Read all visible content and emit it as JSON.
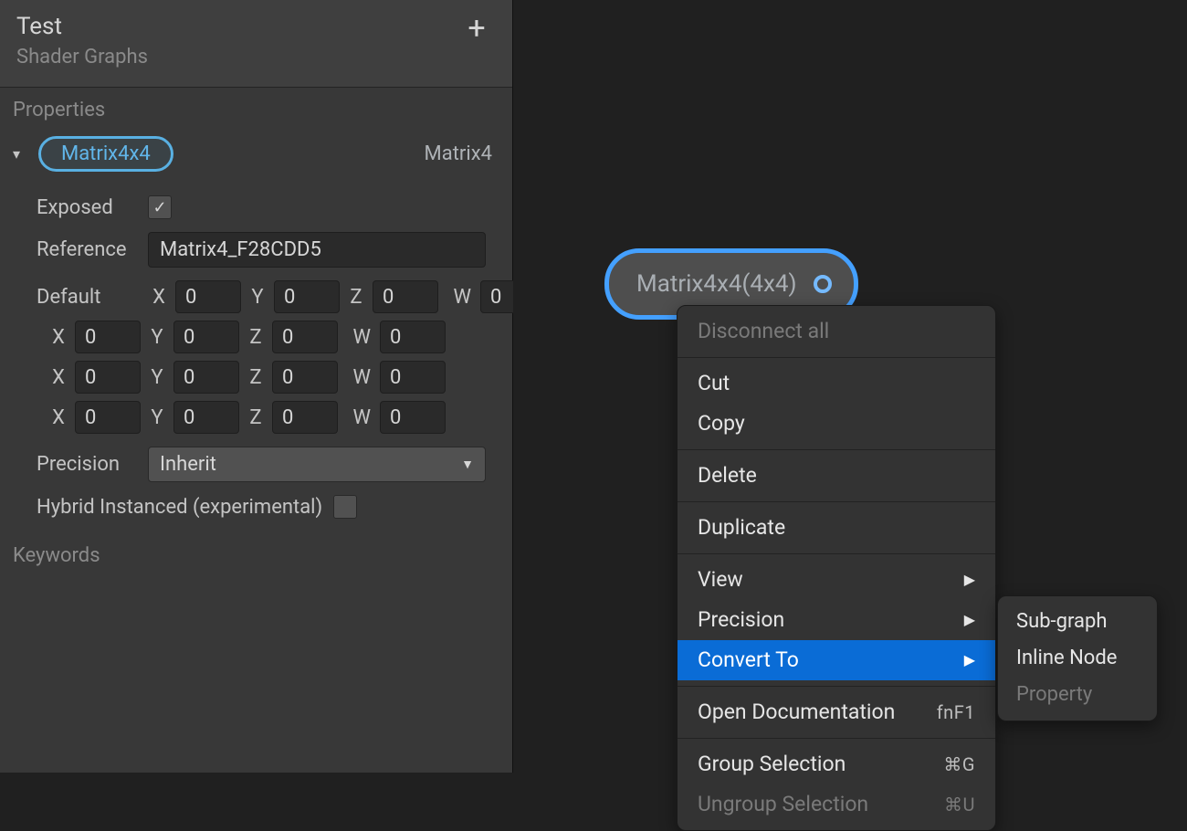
{
  "panel": {
    "title": "Test",
    "subtitle": "Shader Graphs",
    "add_glyph": "+",
    "properties_label": "Properties",
    "keywords_label": "Keywords"
  },
  "property": {
    "chip": "Matrix4x4",
    "type": "Matrix4",
    "exposed_label": "Exposed",
    "exposed_check": "✓",
    "reference_label": "Reference",
    "reference_value": "Matrix4_F28CDD5",
    "default_label": "Default",
    "axes": {
      "x": "X",
      "y": "Y",
      "z": "Z",
      "w": "W"
    },
    "rows": [
      {
        "x": "0",
        "y": "0",
        "z": "0",
        "w": "0"
      },
      {
        "x": "0",
        "y": "0",
        "z": "0",
        "w": "0"
      },
      {
        "x": "0",
        "y": "0",
        "z": "0",
        "w": "0"
      },
      {
        "x": "0",
        "y": "0",
        "z": "0",
        "w": "0"
      }
    ],
    "precision_label": "Precision",
    "precision_value": "Inherit",
    "hybrid_label": "Hybrid Instanced (experimental)"
  },
  "node": {
    "label": "Matrix4x4(4x4)"
  },
  "ctx": {
    "disconnect": "Disconnect all",
    "cut": "Cut",
    "copy": "Copy",
    "delete": "Delete",
    "duplicate": "Duplicate",
    "view": "View",
    "precision": "Precision",
    "convert": "Convert To",
    "open_doc": "Open Documentation",
    "open_doc_sc": "fnF1",
    "group": "Group Selection",
    "group_sc": "⌘G",
    "ungroup": "Ungroup Selection",
    "ungroup_sc": "⌘U"
  },
  "submenu": {
    "subgraph": "Sub-graph",
    "inline": "Inline Node",
    "property": "Property"
  }
}
